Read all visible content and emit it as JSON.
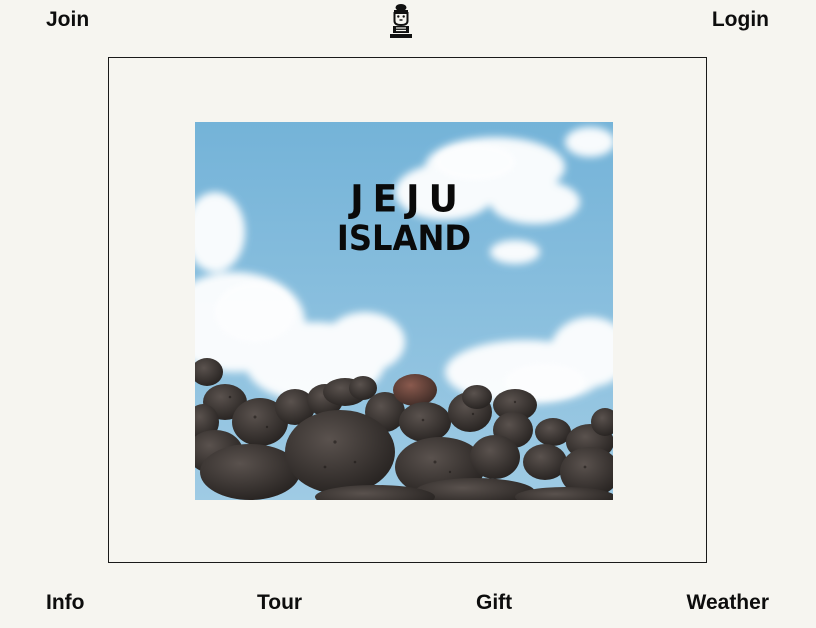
{
  "header": {
    "join_label": "Join",
    "login_label": "Login",
    "logo_icon": "dol-hareubang-statue-icon"
  },
  "hero": {
    "title_line1": "JEJU",
    "title_line2": "ISLAND",
    "image": "sky-with-clouds-and-volcanic-stone-wall"
  },
  "footer_nav": {
    "info_label": "Info",
    "tour_label": "Tour",
    "gift_label": "Gift",
    "weather_label": "Weather"
  },
  "colors": {
    "background": "#f6f5f0",
    "text": "#0d0d0d",
    "sky": "#7fb9d9",
    "stone": "#3a3533"
  }
}
